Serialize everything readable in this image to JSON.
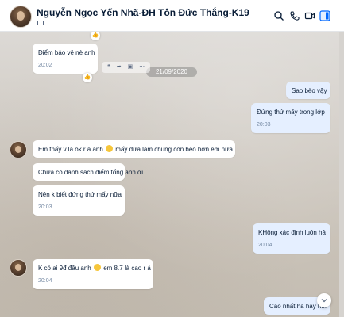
{
  "header": {
    "title": "Nguyễn Ngọc Yến Nhã-ĐH Tôn Đức Thắng-K19",
    "icons": [
      "search-icon",
      "phone-icon",
      "video-icon",
      "sidebar-toggle-icon"
    ]
  },
  "date_separator": "21/09/2020",
  "messages": [
    {
      "side": "left",
      "text": "Điểm bảo vệ nè anh",
      "time": "20:02"
    },
    {
      "side": "right",
      "text": "Sao bèo vậy"
    },
    {
      "side": "right",
      "text": "Đứng thứ mấy trong lớp",
      "time": "20:03"
    },
    {
      "side": "left",
      "text_a": "Em thấy v là ok r á anh",
      "text_b": "mấy đứa làm chung còn bèo hơn em nữa"
    },
    {
      "side": "left",
      "text": "Chưa có danh sách điểm tổng anh ơi"
    },
    {
      "side": "left",
      "text": "Nên k biết đứng thứ mấy nữa",
      "time": "20:03"
    },
    {
      "side": "right",
      "text": "KHông xác định luôn hả",
      "time": "20:04"
    },
    {
      "side": "left",
      "text_a": "K có ai 9đ đâu anh",
      "text_b": "em 8.7 là cao r á",
      "time": "20:04"
    },
    {
      "side": "right",
      "text": "Cao nhất hả hay h..."
    }
  ],
  "message_actions": [
    "quote-icon",
    "share-icon",
    "more-icon"
  ],
  "colors": {
    "my_bubble": "#e5efff",
    "their_bubble": "#ffffff",
    "accent": "#0068ff"
  }
}
